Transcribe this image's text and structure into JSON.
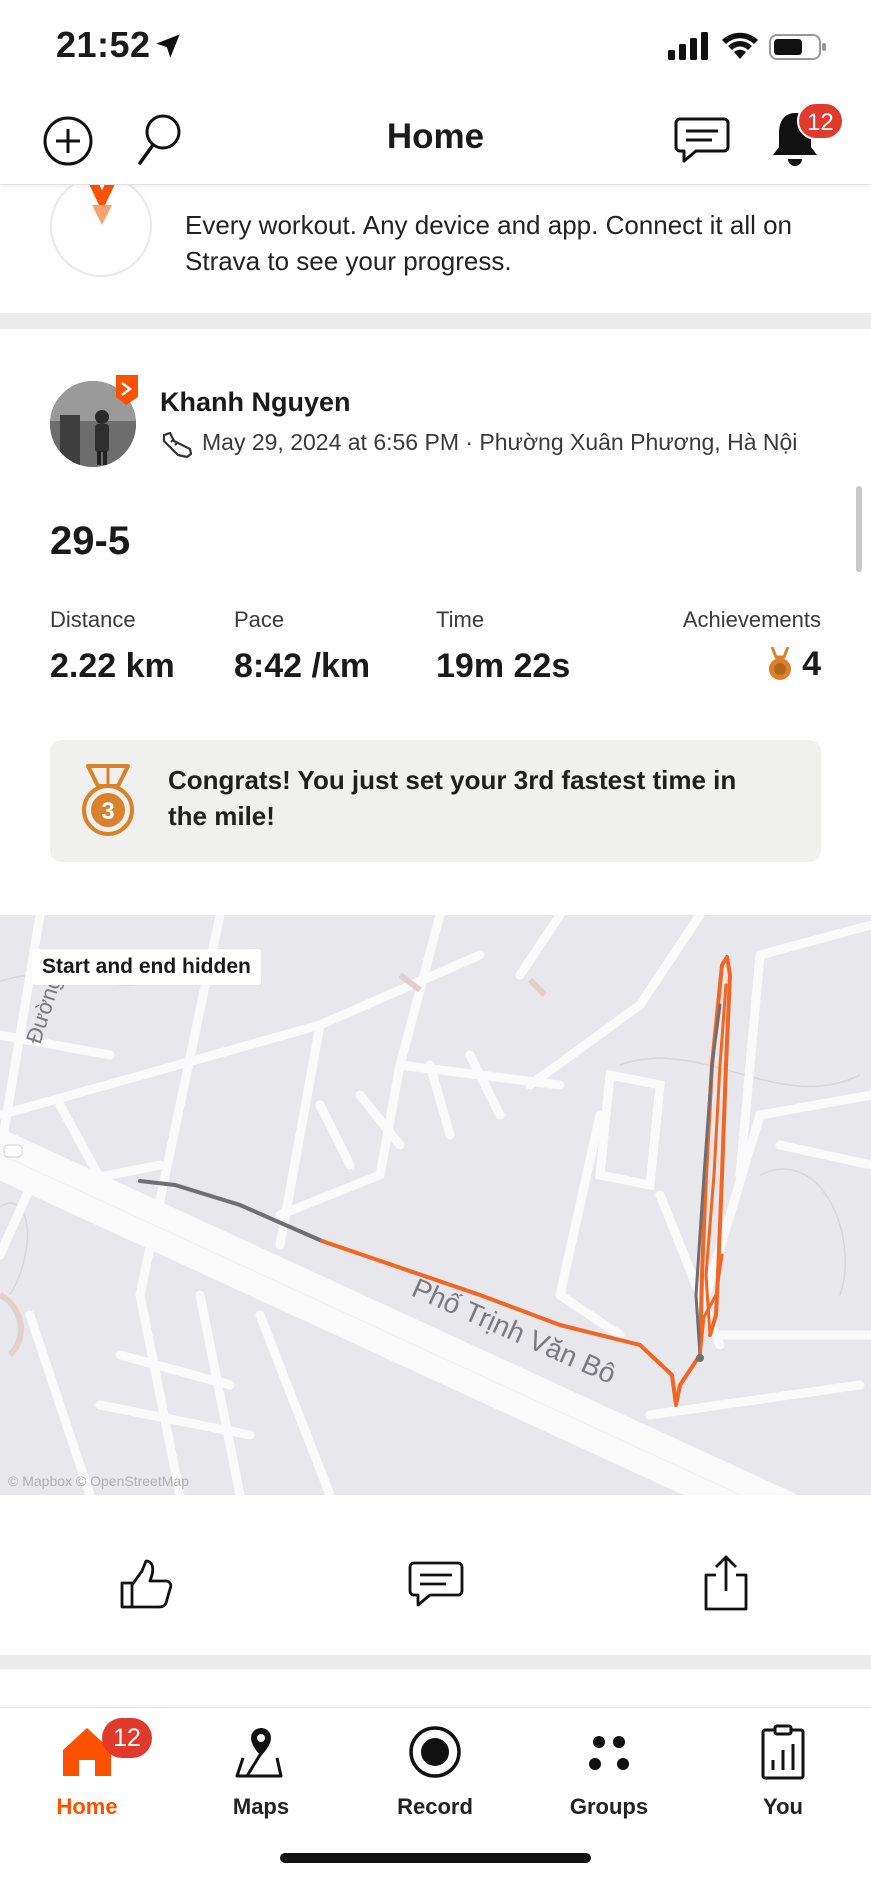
{
  "status_bar": {
    "time": "21:52"
  },
  "app_bar": {
    "title": "Home",
    "notification_count": "12"
  },
  "promo_card": {
    "description": "Every workout. Any device and app. Connect it all on Strava to see your progress."
  },
  "activity": {
    "athlete_name": "Khanh Nguyen",
    "meta": "May 29, 2024 at 6:56 PM · Phường Xuân Phương, Hà Nội",
    "title": "29-5",
    "stats": {
      "distance_label": "Distance",
      "distance_value": "2.22 km",
      "pace_label": "Pace",
      "pace_value": "8:42 /km",
      "time_label": "Time",
      "time_value": "19m 22s",
      "achievements_label": "Achievements",
      "achievements_value": "4"
    },
    "congrats": {
      "medal_number": "3",
      "text": "Congrats! You just set your 3rd fastest time in the mile!"
    },
    "map": {
      "badge": "Start and end hidden",
      "street_name": "Phố Trịnh Văn Bô",
      "street_name_2": "Đường C",
      "attribution": "© Mapbox © OpenStreetMap"
    }
  },
  "tab_bar": {
    "tabs": [
      {
        "label": "Home",
        "badge": "12"
      },
      {
        "label": "Maps"
      },
      {
        "label": "Record"
      },
      {
        "label": "Groups"
      },
      {
        "label": "You"
      }
    ]
  },
  "colors": {
    "brand": "#fc5200",
    "badge": "#e03a2c",
    "route_orange": "#f26522",
    "route_gray": "#6e6e73",
    "medal_bronze": "#d9822b"
  }
}
